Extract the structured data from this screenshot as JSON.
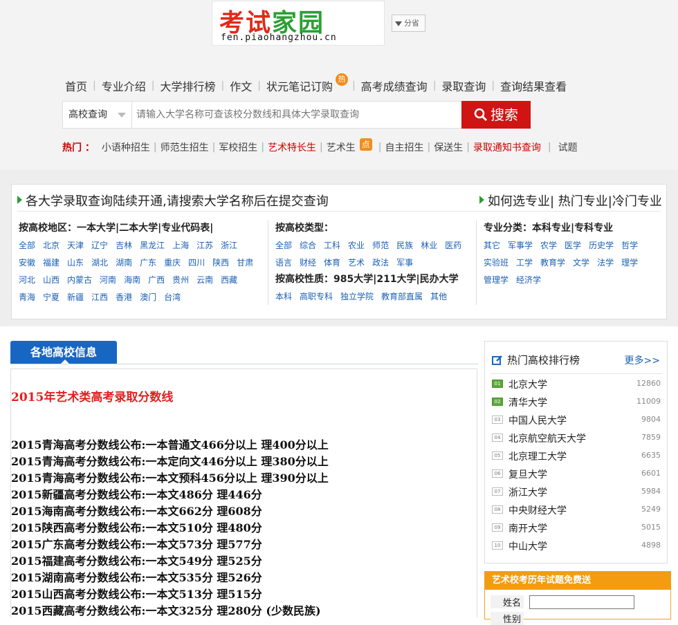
{
  "logo": {
    "main_a": "考试",
    "main_b": "家园",
    "domain": "fen.piaohangzhou.cn"
  },
  "province_btn": "分省",
  "nav": [
    {
      "label": "首页"
    },
    {
      "label": "专业介绍"
    },
    {
      "label": "大学排行榜"
    },
    {
      "label": "作文"
    },
    {
      "label": "状元笔记订购",
      "badge": "热"
    },
    {
      "label": "高考成绩查询"
    },
    {
      "label": "录取查询"
    },
    {
      "label": "查询结果查看"
    }
  ],
  "search": {
    "select": "高校查询",
    "placeholder": "请输入大学名称可查该校分数线和具体大学录取查询",
    "button": "搜索"
  },
  "hot": {
    "label": "热门 ：",
    "items": [
      "小语种招生",
      "师范生招生",
      "军校招生",
      "艺术特长生",
      "艺术生",
      "自主招生",
      "保送生",
      "录取通知书查询",
      "试题"
    ],
    "dian": "点"
  },
  "panel": {
    "title_left": "各大学录取查询陆续开通,请搜索大学名称后在提交查询",
    "title_right": "如何选专业| 热门专业|冷门专业",
    "region_title": "按高校地区：一本大学|二本大学|专业代码表|",
    "regions": [
      "全部",
      "北京",
      "天津",
      "辽宁",
      "吉林",
      "黑龙江",
      "上海",
      "江苏",
      "浙江",
      "安徽",
      "福建",
      "山东",
      "湖北",
      "湖南",
      "广东",
      "重庆",
      "四川",
      "陕西",
      "甘肃",
      "河北",
      "山西",
      "内蒙古",
      "河南",
      "海南",
      "广西",
      "贵州",
      "云南",
      "西藏",
      "青海",
      "宁夏",
      "新疆",
      "江西",
      "香港",
      "澳门",
      "台湾"
    ],
    "type_title": "按高校类型：",
    "types": [
      "全部",
      "综合",
      "工科",
      "农业",
      "师范",
      "民族",
      "林业",
      "医药",
      "语言",
      "财经",
      "体育",
      "艺术",
      "政法",
      "军事"
    ],
    "nature_title": "按高校性质：985大学|211大学|民办大学",
    "natures": [
      "本科",
      "高职专科",
      "独立学院",
      "教育部直属",
      "其他"
    ],
    "major_title": "专业分类：本科专业|专科专业",
    "majors": [
      "其它",
      "军事学",
      "农学",
      "医学",
      "历史学",
      "哲学",
      "实验班",
      "工学",
      "教育学",
      "文学",
      "法学",
      "理学",
      "管理学",
      "经济学"
    ]
  },
  "tab": "各地高校信息",
  "article": {
    "title": "2015年艺术类高考录取分数线",
    "lines": [
      "2015青海高考分数线公布:一本普通文466分以上 理400分以上",
      "2015青海高考分数线公布:一本定向文446分以上 理380分以上",
      "2015青海高考分数线公布:一本文预科456分以上 理390分以上",
      "2015新疆高考分数线公布:一本文486分 理446分",
      "2015海南高考分数线公布:一本文662分 理608分",
      "2015陕西高考分数线公布:一本文510分 理480分",
      "2015广东高考分数线公布:一本文573分 理577分",
      "2015福建高考分数线公布:一本文549分 理525分",
      "2015湖南高考分数线公布:一本文535分 理526分",
      "2015山西高考分数线公布:一本文513分 理515分",
      "2015西藏高考分数线公布:一本文325分 理280分 (少数民族)"
    ]
  },
  "ranking": {
    "title": "热门高校排行榜",
    "more": "更多>>",
    "items": [
      {
        "no": "01",
        "name": "北京大学",
        "count": "12860"
      },
      {
        "no": "02",
        "name": "清华大学",
        "count": "11009"
      },
      {
        "no": "03",
        "name": "中国人民大学",
        "count": "9804"
      },
      {
        "no": "04",
        "name": "北京航空航天大学",
        "count": "7859"
      },
      {
        "no": "05",
        "name": "北京理工大学",
        "count": "6635"
      },
      {
        "no": "06",
        "name": "复旦大学",
        "count": "6601"
      },
      {
        "no": "07",
        "name": "浙江大学",
        "count": "5984"
      },
      {
        "no": "08",
        "name": "中央财经大学",
        "count": "5249"
      },
      {
        "no": "09",
        "name": "南开大学",
        "count": "5015"
      },
      {
        "no": "10",
        "name": "中山大学",
        "count": "4898"
      }
    ]
  },
  "promo": {
    "title": "艺术校考历年试题免费送",
    "name_label": "姓名",
    "gender_label": "性别"
  }
}
